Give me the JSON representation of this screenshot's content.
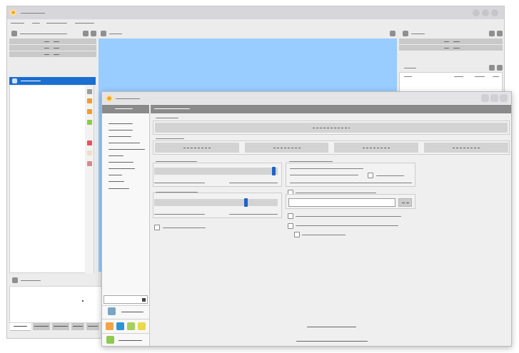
{
  "theme": {
    "selection_color": "#1b6fd1",
    "canvas_color": "#99ccff",
    "slider_handle_color": "#1e63c6",
    "header_strip_color": "#8a8a8a"
  },
  "background_window": {
    "app_icon": "app-logo-icon",
    "window_controls": [
      "minimize-icon",
      "maximize-icon",
      "close-icon"
    ],
    "list_markers": [
      "#9c9c9c",
      "#f29b2b",
      "#f29b2b",
      "#8fcb3e",
      "#e9505c",
      "#eedfc3",
      "#d88a8f"
    ]
  },
  "dialog": {
    "app_icon": "app-logo-icon",
    "window_controls": [
      "minimize-icon",
      "maximize-icon",
      "close-icon"
    ],
    "sliders": [
      {
        "value": 0.98
      },
      {
        "value": 0.75
      }
    ],
    "checkboxes": [
      false,
      false,
      false,
      false,
      false,
      false
    ],
    "sidebar_badge_color": "#79a6c4",
    "swatches": [
      "#f1a54b",
      "#2f93d6",
      "#a7cf5b",
      "#ead94a"
    ],
    "status_color": "#8fc94d"
  }
}
